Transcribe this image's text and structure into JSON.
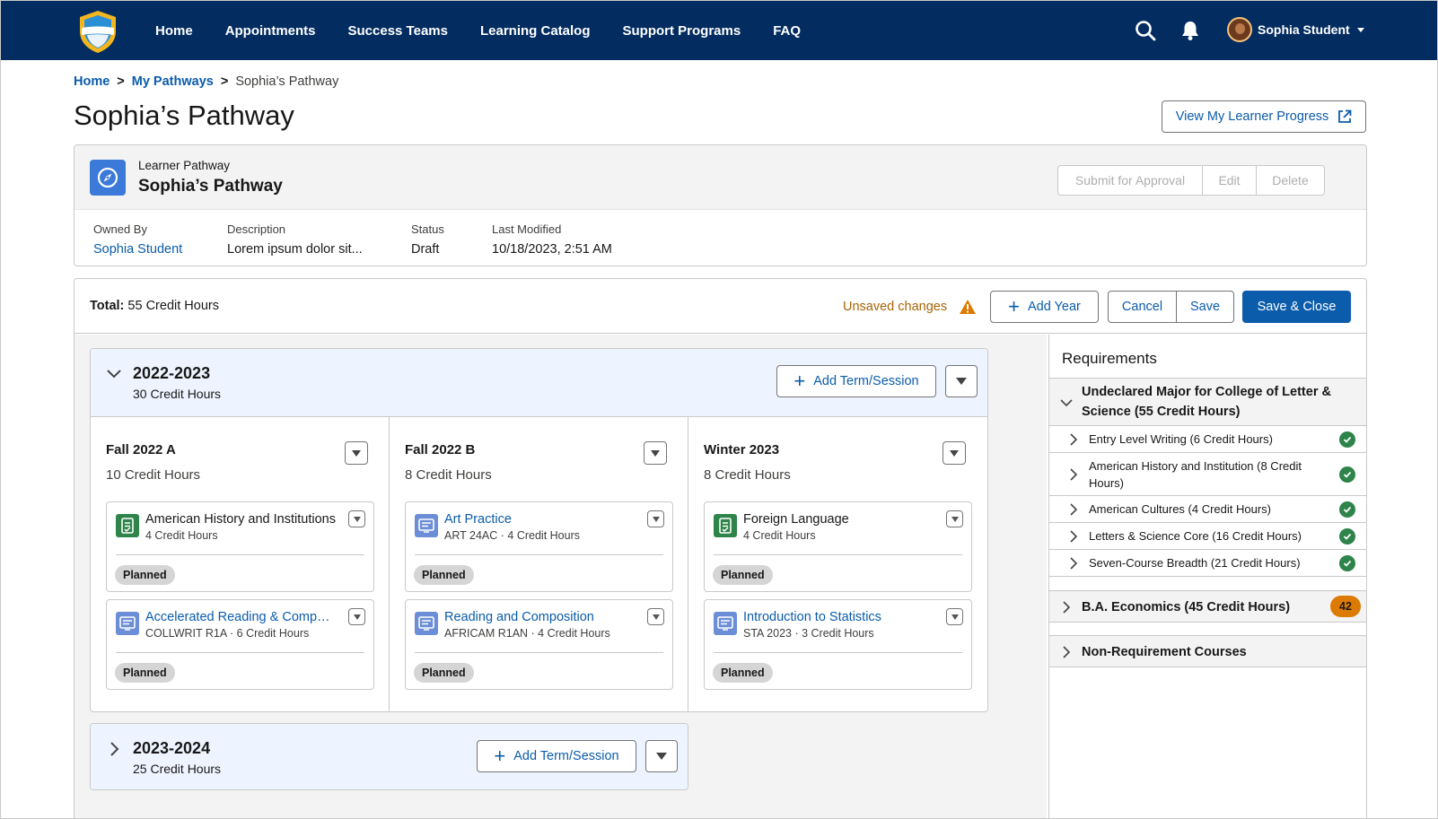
{
  "nav": {
    "links": [
      "Home",
      "Appointments",
      "Success Teams",
      "Learning Catalog",
      "Support Programs",
      "FAQ"
    ],
    "user_name": "Sophia Student",
    "icons": [
      "search-icon",
      "bell-icon",
      "shield-logo"
    ]
  },
  "breadcrumb": {
    "home": "Home",
    "pathways": "My Pathways",
    "current": "Sophia’s Pathway",
    "sep": ">"
  },
  "page_title": "Sophia’s Pathway",
  "view_progress_label": "View My Learner Progress",
  "record": {
    "object_label": "Learner Pathway",
    "name": "Sophia’s Pathway",
    "actions": {
      "submit": "Submit for Approval",
      "edit": "Edit",
      "delete": "Delete"
    },
    "fields": {
      "owned_by_label": "Owned By",
      "owned_by": "Sophia Student",
      "description_label": "Description",
      "description": "Lorem ipsum dolor sit...",
      "status_label": "Status",
      "status": "Draft",
      "modified_label": "Last Modified",
      "modified": "10/18/2023, 2:51 AM"
    }
  },
  "toolbar": {
    "total_label": "Total:",
    "total_value": "55 Credit Hours",
    "unsaved": "Unsaved changes",
    "add_year": "Add Year",
    "cancel": "Cancel",
    "save": "Save",
    "save_close": "Save & Close"
  },
  "add_term_label": "Add Term/Session",
  "years": [
    {
      "title": "2022-2023",
      "credits": "30 Credit Hours",
      "expanded": true,
      "terms": [
        {
          "title": "Fall 2022 A",
          "credits": "10 Credit Hours",
          "courses": [
            {
              "name": "American History and Institutions",
              "sub": "4 Credit Hours",
              "status": "Planned",
              "icon": "requirement-icon",
              "link": false
            },
            {
              "name": "Accelerated Reading & Composition",
              "sub": "COLLWRIT R1A · 6 Credit Hours",
              "status": "Planned",
              "icon": "course-icon",
              "link": true
            }
          ]
        },
        {
          "title": "Fall 2022 B",
          "credits": "8 Credit Hours",
          "courses": [
            {
              "name": "Art Practice",
              "sub": "ART 24AC · 4 Credit Hours",
              "status": "Planned",
              "icon": "course-icon",
              "link": true
            },
            {
              "name": "Reading and Composition",
              "sub": "AFRICAM R1AN · 4 Credit Hours",
              "status": "Planned",
              "icon": "course-icon",
              "link": true
            }
          ]
        },
        {
          "title": "Winter 2023",
          "credits": "8 Credit Hours",
          "courses": [
            {
              "name": "Foreign Language",
              "sub": "4 Credit Hours",
              "status": "Planned",
              "icon": "requirement-icon",
              "link": false
            },
            {
              "name": "Introduction to Statistics",
              "sub": "STA 2023 · 3 Credit Hours",
              "status": "Planned",
              "icon": "course-icon",
              "link": true
            }
          ]
        }
      ]
    },
    {
      "title": "2023-2024",
      "credits": "25 Credit Hours",
      "expanded": false,
      "terms": []
    }
  ],
  "requirements": {
    "title": "Requirements",
    "groups": [
      {
        "label": "Undeclared Major for College of Letter & Science (55 Credit Hours)",
        "expanded": true,
        "items": [
          {
            "label": "Entry Level Writing (6 Credit Hours)",
            "complete": true
          },
          {
            "label": "American History and Institution (8 Credit Hours)",
            "complete": true
          },
          {
            "label": "American Cultures (4 Credit Hours)",
            "complete": true
          },
          {
            "label": "Letters & Science Core (16 Credit Hours)",
            "complete": true
          },
          {
            "label": "Seven-Course Breadth (21 Credit Hours)",
            "complete": true
          }
        ]
      },
      {
        "label": "B.A. Economics (45 Credit Hours)",
        "expanded": false,
        "badge": "42"
      },
      {
        "label": "Non-Requirement Courses",
        "expanded": false
      }
    ]
  },
  "colors": {
    "nav": "#032d60",
    "brand": "#0b5cab",
    "warning": "#dd7a01",
    "success": "#2e844a"
  }
}
